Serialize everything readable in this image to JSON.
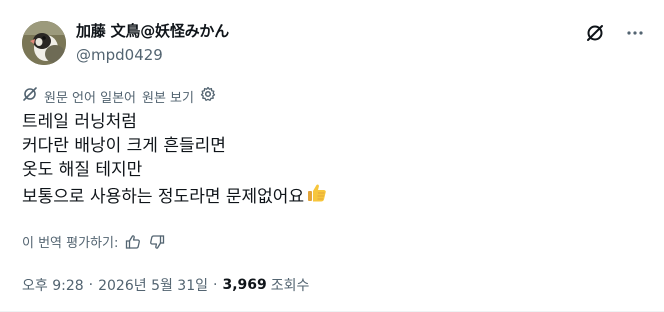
{
  "author": {
    "display_name": "加藤 文鳥@妖怪みかん",
    "handle": "@mpd0429"
  },
  "icons": {
    "avatar": "bird-avatar",
    "grok": "grok-icon",
    "more": "more-icon",
    "translate": "translate-icon",
    "settings": "gear-icon",
    "like": "thumbs-up-icon",
    "dislike": "thumbs-down-icon"
  },
  "translation": {
    "source_label": "원문 언어 일본어",
    "show_original": "원본 보기"
  },
  "post": {
    "lines": [
      "트레일 러닝처럼",
      "커다란 배낭이 크게 흔들리면",
      "옷도 해질 테지만",
      "보통으로 사용하는 정도라면 문제없어요"
    ],
    "emoji": "thumbs-up"
  },
  "rating": {
    "label": "이 번역 평가하기:"
  },
  "meta": {
    "time": "오후 9:28",
    "separator": "·",
    "date": "2026년 5월 31일",
    "views_count": "3,969",
    "views_label": "조회수"
  }
}
